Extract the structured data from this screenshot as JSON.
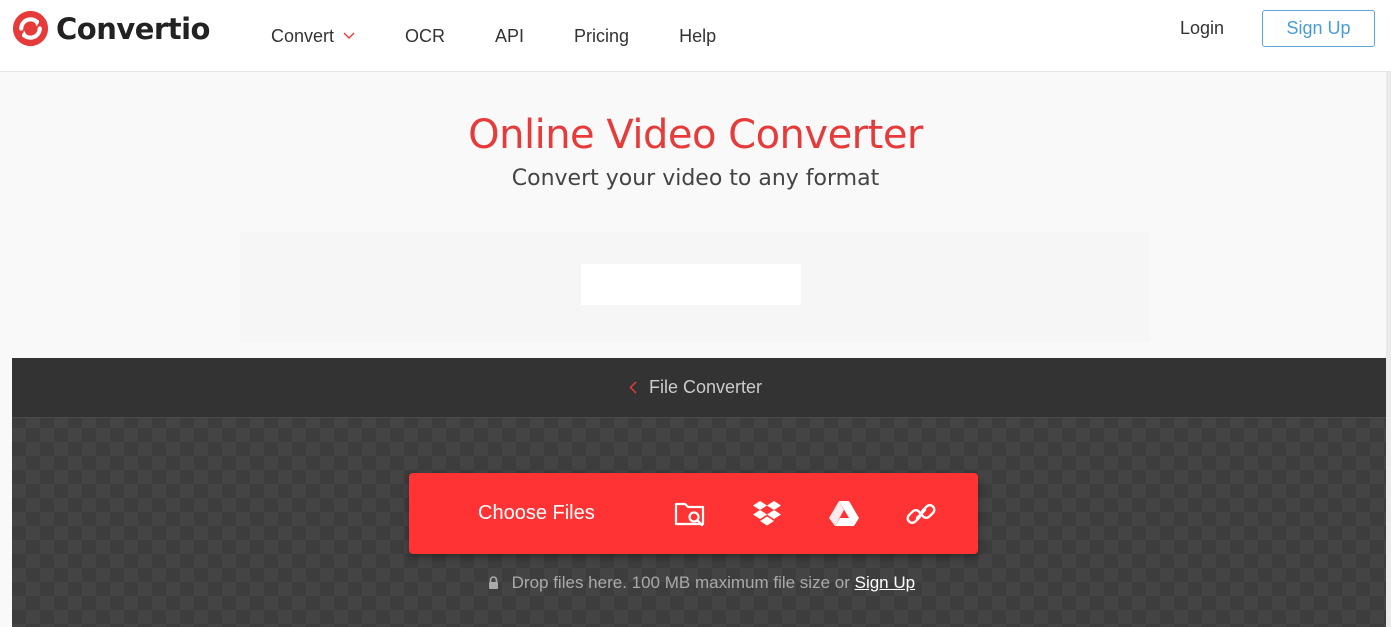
{
  "brand": {
    "name": "Convertio",
    "accent": "#e73b3b"
  },
  "nav": {
    "items": [
      {
        "label": "Convert",
        "has_dropdown": true
      },
      {
        "label": "OCR"
      },
      {
        "label": "API"
      },
      {
        "label": "Pricing"
      },
      {
        "label": "Help"
      }
    ],
    "login": "Login",
    "signup": "Sign Up"
  },
  "hero": {
    "title": "Online Video Converter",
    "subtitle": "Convert your video to any format"
  },
  "converter": {
    "breadcrumb": "File Converter",
    "choose_files": "Choose Files",
    "sources": [
      "folder-search-icon",
      "dropbox-icon",
      "google-drive-icon",
      "link-icon"
    ],
    "drop_text": "Drop files here. 100 MB maximum file size or",
    "drop_link": "Sign Up",
    "button_color": "#ff3333"
  }
}
